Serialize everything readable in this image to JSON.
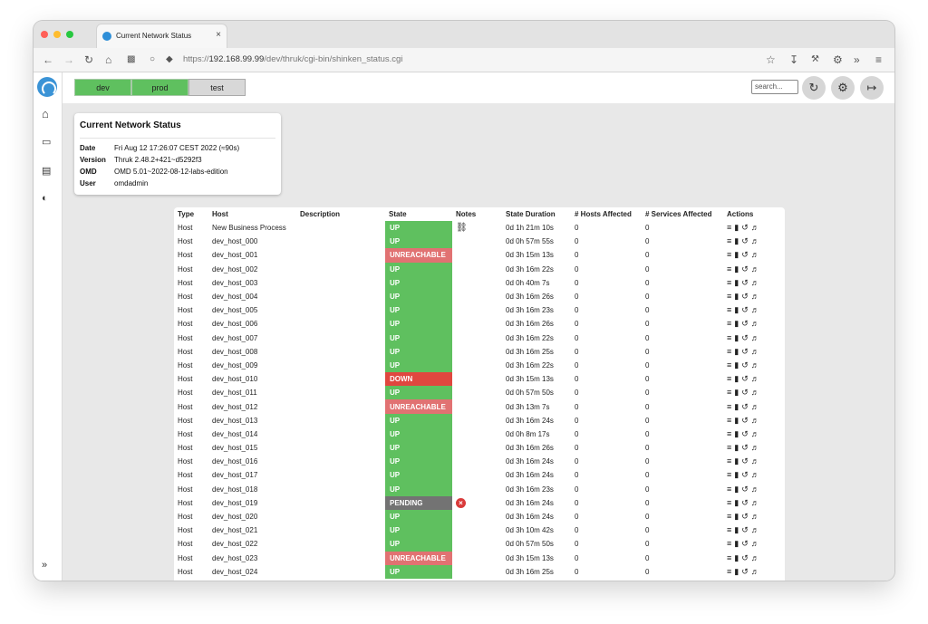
{
  "browser": {
    "tab_title": "Current Network Status",
    "tab_close": "×",
    "url_prefix": "https://",
    "url_host": "192.168.99.99",
    "url_path": "/dev/thruk/cgi-bin/shinken_status.cgi"
  },
  "env_tabs": [
    "dev",
    "prod",
    "test"
  ],
  "search": {
    "placeholder": "search..."
  },
  "info_card": {
    "title": "Current Network Status",
    "rows": [
      {
        "key": "Date",
        "value": "Fri Aug 12 17:26:07 CEST 2022 (≈90s)"
      },
      {
        "key": "Version",
        "value": "Thruk 2.48.2+421~d5292f3"
      },
      {
        "key": "OMD",
        "value": "OMD 5.01~2022-08-12-labs-edition"
      },
      {
        "key": "User",
        "value": "omdadmin"
      }
    ]
  },
  "table": {
    "headers": [
      "Type",
      "Host",
      "Description",
      "State",
      "Notes",
      "State Duration",
      "# Hosts Affected",
      "# Services Affected",
      "Actions"
    ],
    "rows": [
      {
        "type": "Host",
        "host": "New Business Process",
        "state": "UP",
        "notes": "sitemap",
        "duration": "0d 1h 21m 10s",
        "hosts": "0",
        "services": "0"
      },
      {
        "type": "Host",
        "host": "dev_host_000",
        "state": "UP",
        "notes": "",
        "duration": "0d 0h 57m 55s",
        "hosts": "0",
        "services": "0"
      },
      {
        "type": "Host",
        "host": "dev_host_001",
        "state": "UNREACHABLE",
        "notes": "",
        "duration": "0d 3h 15m 13s",
        "hosts": "0",
        "services": "0"
      },
      {
        "type": "Host",
        "host": "dev_host_002",
        "state": "UP",
        "notes": "",
        "duration": "0d 3h 16m 22s",
        "hosts": "0",
        "services": "0"
      },
      {
        "type": "Host",
        "host": "dev_host_003",
        "state": "UP",
        "notes": "",
        "duration": "0d 0h 40m 7s",
        "hosts": "0",
        "services": "0"
      },
      {
        "type": "Host",
        "host": "dev_host_004",
        "state": "UP",
        "notes": "",
        "duration": "0d 3h 16m 26s",
        "hosts": "0",
        "services": "0"
      },
      {
        "type": "Host",
        "host": "dev_host_005",
        "state": "UP",
        "notes": "",
        "duration": "0d 3h 16m 23s",
        "hosts": "0",
        "services": "0"
      },
      {
        "type": "Host",
        "host": "dev_host_006",
        "state": "UP",
        "notes": "",
        "duration": "0d 3h 16m 26s",
        "hosts": "0",
        "services": "0"
      },
      {
        "type": "Host",
        "host": "dev_host_007",
        "state": "UP",
        "notes": "",
        "duration": "0d 3h 16m 22s",
        "hosts": "0",
        "services": "0"
      },
      {
        "type": "Host",
        "host": "dev_host_008",
        "state": "UP",
        "notes": "",
        "duration": "0d 3h 16m 25s",
        "hosts": "0",
        "services": "0"
      },
      {
        "type": "Host",
        "host": "dev_host_009",
        "state": "UP",
        "notes": "",
        "duration": "0d 3h 16m 22s",
        "hosts": "0",
        "services": "0"
      },
      {
        "type": "Host",
        "host": "dev_host_010",
        "state": "DOWN",
        "notes": "",
        "duration": "0d 3h 15m 13s",
        "hosts": "0",
        "services": "0"
      },
      {
        "type": "Host",
        "host": "dev_host_011",
        "state": "UP",
        "notes": "",
        "duration": "0d 0h 57m 50s",
        "hosts": "0",
        "services": "0"
      },
      {
        "type": "Host",
        "host": "dev_host_012",
        "state": "UNREACHABLE",
        "notes": "",
        "duration": "0d 3h 13m 7s",
        "hosts": "0",
        "services": "0"
      },
      {
        "type": "Host",
        "host": "dev_host_013",
        "state": "UP",
        "notes": "",
        "duration": "0d 3h 16m 24s",
        "hosts": "0",
        "services": "0"
      },
      {
        "type": "Host",
        "host": "dev_host_014",
        "state": "UP",
        "notes": "",
        "duration": "0d 0h 8m 17s",
        "hosts": "0",
        "services": "0"
      },
      {
        "type": "Host",
        "host": "dev_host_015",
        "state": "UP",
        "notes": "",
        "duration": "0d 3h 16m 26s",
        "hosts": "0",
        "services": "0"
      },
      {
        "type": "Host",
        "host": "dev_host_016",
        "state": "UP",
        "notes": "",
        "duration": "0d 3h 16m 24s",
        "hosts": "0",
        "services": "0"
      },
      {
        "type": "Host",
        "host": "dev_host_017",
        "state": "UP",
        "notes": "",
        "duration": "0d 3h 16m 24s",
        "hosts": "0",
        "services": "0"
      },
      {
        "type": "Host",
        "host": "dev_host_018",
        "state": "UP",
        "notes": "",
        "duration": "0d 3h 16m 23s",
        "hosts": "0",
        "services": "0"
      },
      {
        "type": "Host",
        "host": "dev_host_019",
        "state": "PENDING",
        "notes": "error",
        "duration": "0d 3h 16m 24s",
        "hosts": "0",
        "services": "0"
      },
      {
        "type": "Host",
        "host": "dev_host_020",
        "state": "UP",
        "notes": "",
        "duration": "0d 3h 16m 24s",
        "hosts": "0",
        "services": "0"
      },
      {
        "type": "Host",
        "host": "dev_host_021",
        "state": "UP",
        "notes": "",
        "duration": "0d 3h 10m 42s",
        "hosts": "0",
        "services": "0"
      },
      {
        "type": "Host",
        "host": "dev_host_022",
        "state": "UP",
        "notes": "",
        "duration": "0d 0h 57m 50s",
        "hosts": "0",
        "services": "0"
      },
      {
        "type": "Host",
        "host": "dev_host_023",
        "state": "UNREACHABLE",
        "notes": "",
        "duration": "0d 3h 15m 13s",
        "hosts": "0",
        "services": "0"
      },
      {
        "type": "Host",
        "host": "dev_host_024",
        "state": "UP",
        "notes": "",
        "duration": "0d 3h 16m 25s",
        "hosts": "0",
        "services": "0"
      }
    ]
  },
  "colors": {
    "up": "#5fc05f",
    "unreachable": "#e17272",
    "down": "#e0473f",
    "pending": "#737373",
    "env_active": "#5fc05f",
    "env_inactive": "#d8d8d8"
  },
  "icons": [
    "home-icon",
    "monitor-icon",
    "book-icon",
    "gauge-icon",
    "expand-icon",
    "refresh-icon",
    "gear-icon",
    "logout-icon",
    "list-icon",
    "bar-chart-icon",
    "history-icon",
    "speaker-icon",
    "sitemap-icon",
    "error-icon"
  ]
}
